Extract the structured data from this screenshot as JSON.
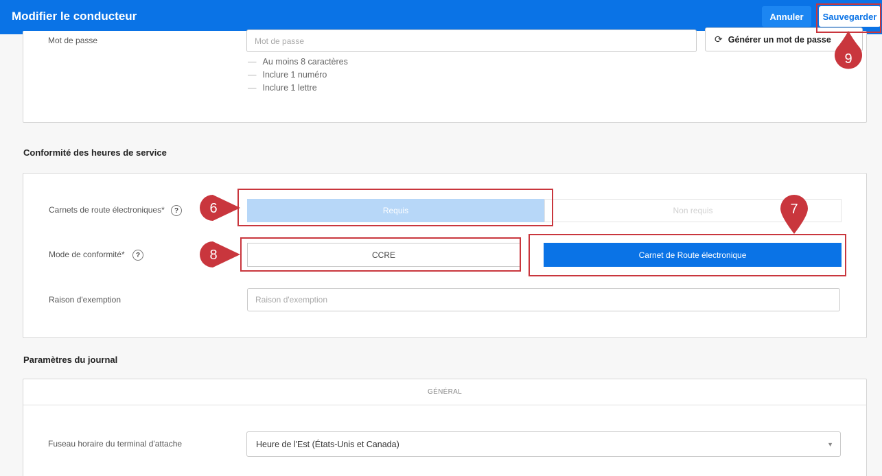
{
  "header": {
    "title": "Modifier le conducteur",
    "cancel_label": "Annuler",
    "save_label": "Sauvegarder"
  },
  "password": {
    "label": "Mot de passe",
    "placeholder": "Mot de passe",
    "generate_label": "Générer un mot de passe",
    "requirements": [
      "Au moins 8 caractères",
      "Inclure 1 numéro",
      "Inclure 1 lettre"
    ]
  },
  "hos": {
    "section_title": "Conformité des heures de service",
    "eld_label": "Carnets de route électroniques*",
    "eld_options": [
      "Requis",
      "Non requis"
    ],
    "eld_selected": "Requis",
    "mode_label": "Mode de conformité*",
    "mode_options": [
      "CCRE",
      "Carnet de Route électronique"
    ],
    "mode_selected": "Carnet de Route électronique",
    "exemption_label": "Raison d'exemption",
    "exemption_placeholder": "Raison d'exemption"
  },
  "journal": {
    "section_title": "Paramètres du journal",
    "tab_label": "GÉNÉRAL",
    "timezone_label": "Fuseau horaire du terminal d'attache",
    "timezone_value": "Heure de l'Est (États-Unis et Canada)"
  },
  "annotations": {
    "markers": [
      "6",
      "7",
      "8",
      "9"
    ],
    "color": "#c9363d"
  },
  "colors": {
    "primary": "#0a73e6",
    "selected_light": "#b7d7f8"
  }
}
